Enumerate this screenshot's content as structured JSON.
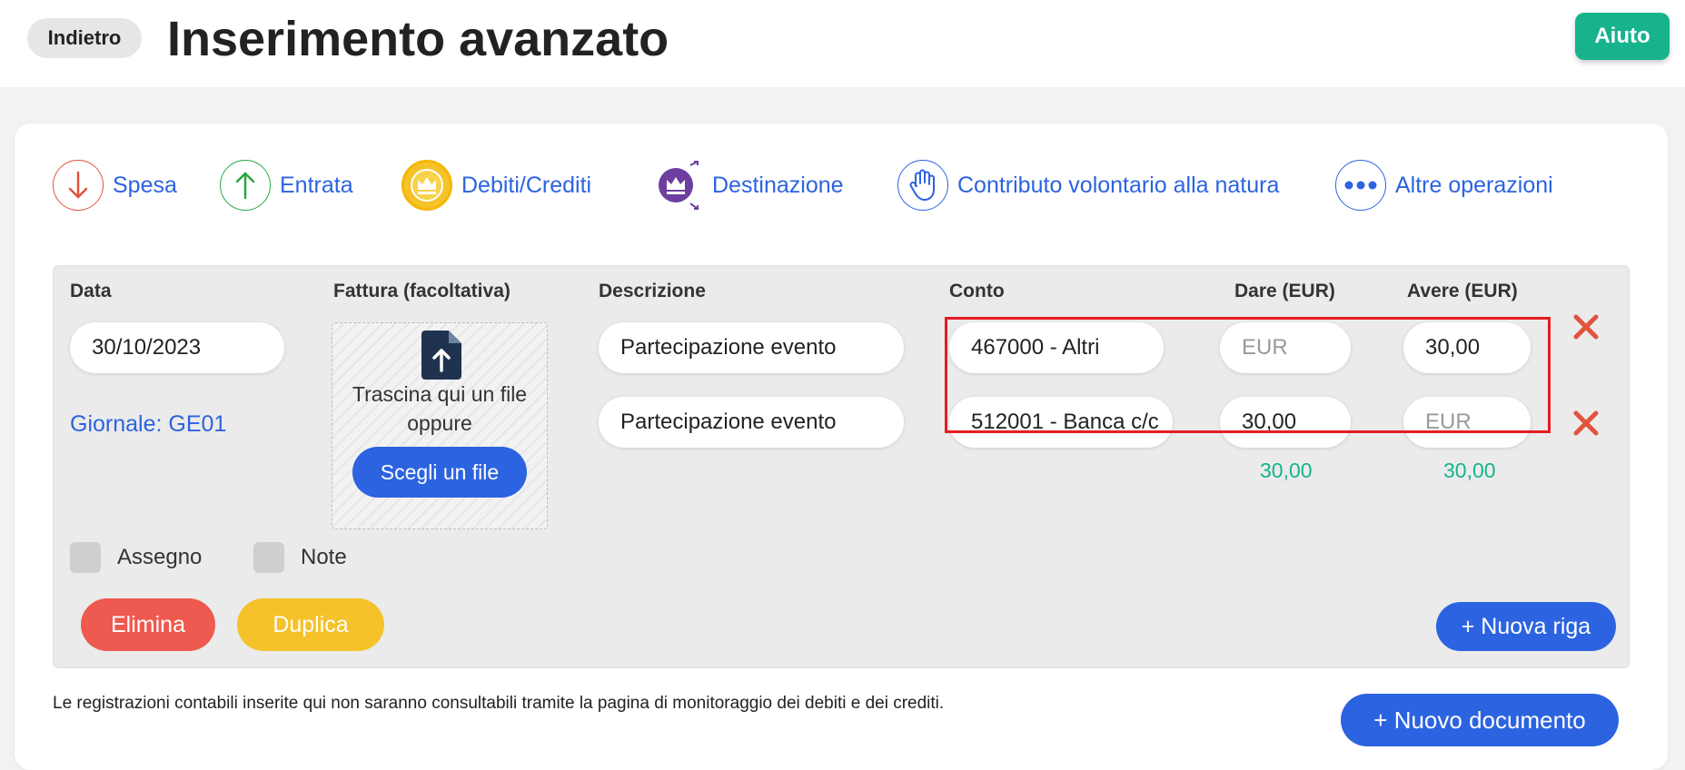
{
  "header": {
    "back_label": "Indietro",
    "title": "Inserimento avanzato",
    "help_label": "Aiuto"
  },
  "operations": [
    {
      "label": "Spesa",
      "icon": "arrow-down-icon",
      "color": "#e2533e"
    },
    {
      "label": "Entrata",
      "icon": "arrow-up-icon",
      "color": "#28a745"
    },
    {
      "label": "Debiti/Crediti",
      "icon": "crown-icon",
      "color": "#f5b700"
    },
    {
      "label": "Destinazione",
      "icon": "crown-transfer-icon",
      "color": "#6c3fa0"
    },
    {
      "label": "Contributo volontario alla natura",
      "icon": "hand-icon",
      "color": "#2c63e0"
    },
    {
      "label": "Altre operazioni",
      "icon": "more-icon",
      "color": "#2c63e0"
    }
  ],
  "entry": {
    "columns": {
      "date": "Data",
      "invoice": "Fattura (facoltativa)",
      "description": "Descrizione",
      "account": "Conto",
      "debit": "Dare (EUR)",
      "credit": "Avere (EUR)"
    },
    "date_value": "30/10/2023",
    "journal": "Giornale: GE01",
    "upload": {
      "text": "Trascina qui un file oppure",
      "button": "Scegli un file"
    },
    "rows": [
      {
        "description": "Partecipazione evento",
        "account": "467000 - Altri",
        "debit": "",
        "credit": "30,00"
      },
      {
        "description": "Partecipazione evento",
        "account": "512001 - Banca c/c",
        "debit": "30,00",
        "credit": ""
      }
    ],
    "amount_placeholder": "EUR",
    "totals": {
      "debit": "30,00",
      "credit": "30,00"
    },
    "checkboxes": {
      "cheque": "Assegno",
      "notes": "Note"
    },
    "buttons": {
      "delete": "Elimina",
      "duplicate": "Duplica",
      "new_row": "+ Nuova riga"
    }
  },
  "footnote": "Le registrazioni contabili inserite qui non saranno consultabili tramite la pagina di monitoraggio dei debiti e dei crediti.",
  "new_document_label": "+ Nuovo documento",
  "colors": {
    "accent_blue": "#2c63e0",
    "green": "#16b38d",
    "red": "#e2533e",
    "yellow": "#f5c22a",
    "highlight": "#e51c23"
  }
}
